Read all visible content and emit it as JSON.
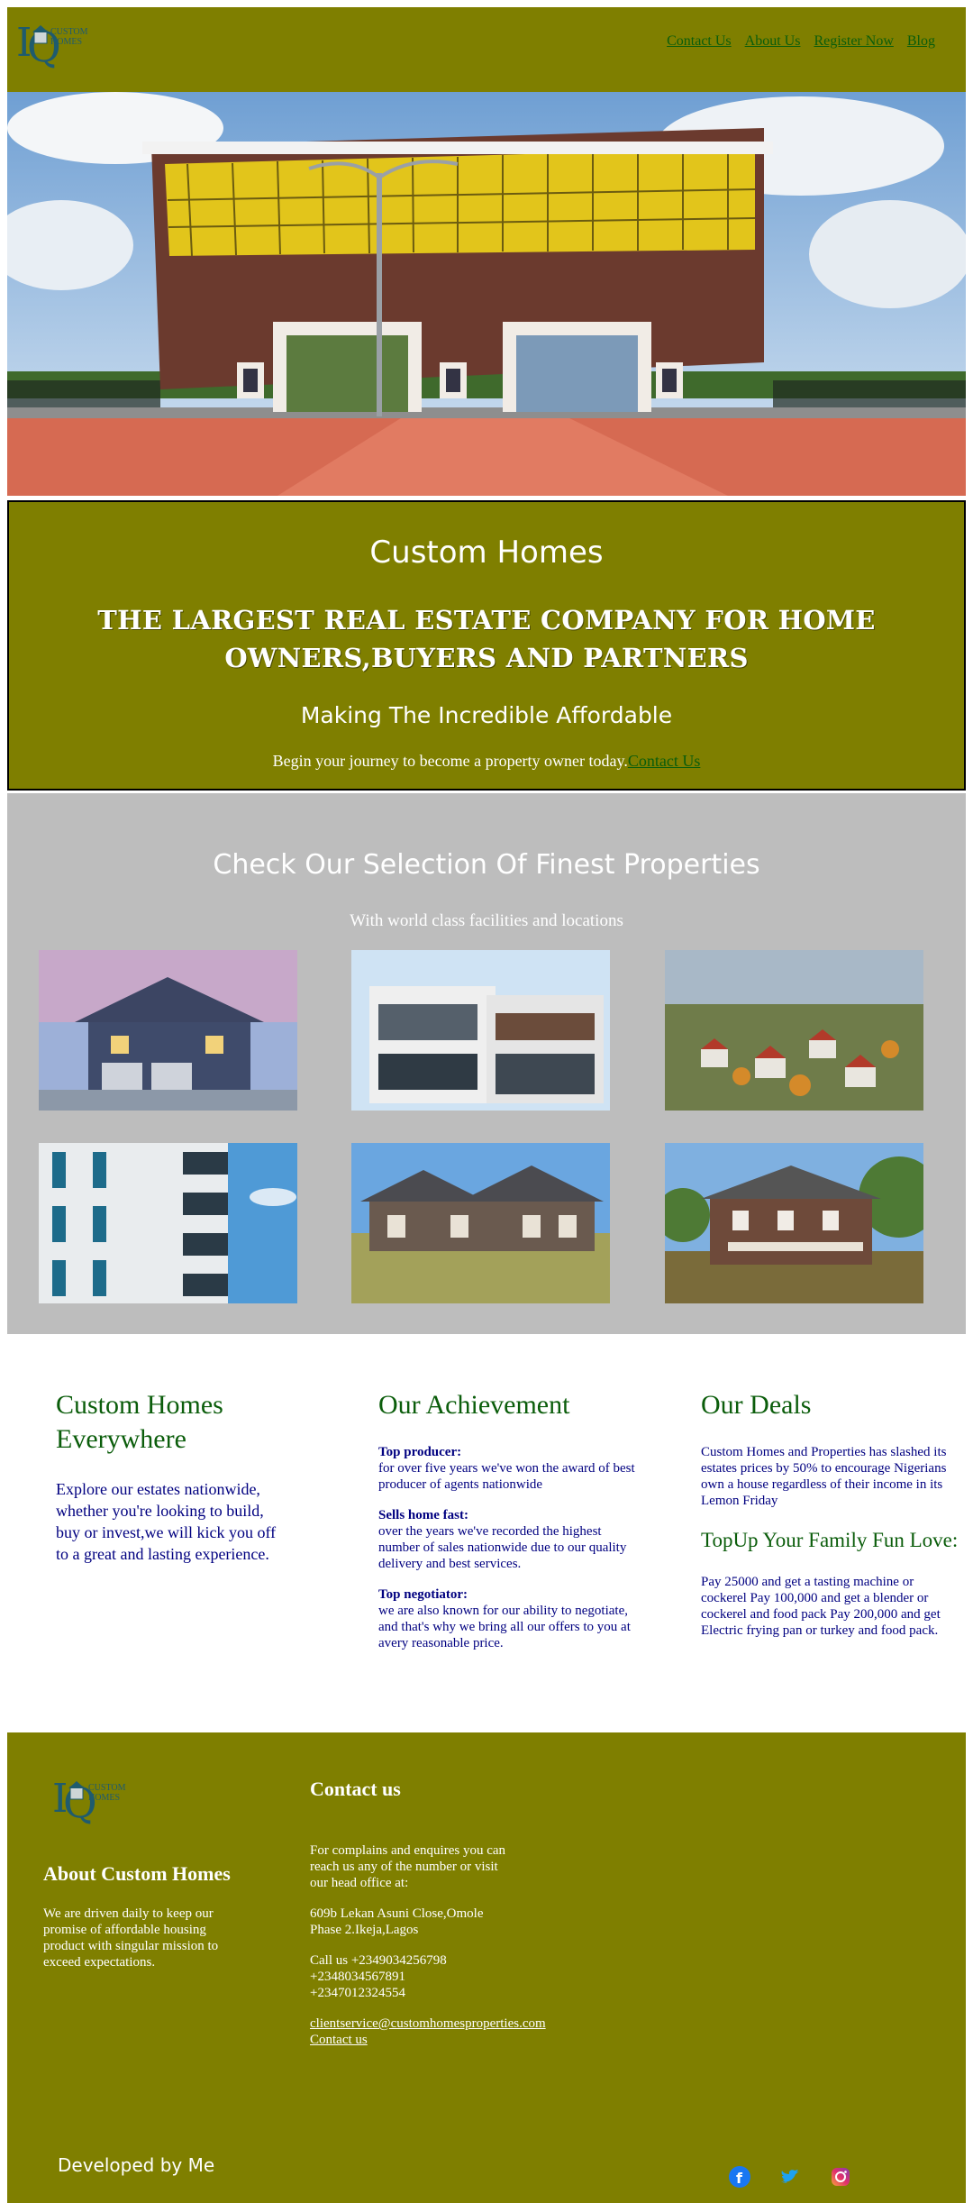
{
  "brand": {
    "logo_text": "CUSTOM HOMES",
    "logo_sub": "Making The Incredible Affordable"
  },
  "nav": {
    "items": [
      "Contact Us",
      "About Us",
      "Register Now",
      "Blog"
    ]
  },
  "intro": {
    "brand": "Custom Homes",
    "headline": "THE LARGEST REAL ESTATE COMPANY FOR HOME OWNERS,BUYERS AND PARTNERS",
    "tagline": "Making The Incredible Affordable",
    "journey_text": "Begin your journey to become a property owner today.",
    "journey_link": "Contact Us"
  },
  "properties": {
    "title": "Check Our Selection Of Finest Properties",
    "subtitle": "With world class facilities and locations"
  },
  "columns": {
    "col1": {
      "title": "Custom Homes Everywhere",
      "text": "Explore our estates nationwide, whether you're looking to build, buy or invest,we will kick you off to a great and lasting experience."
    },
    "col2": {
      "title": "Our Achievement",
      "items": [
        {
          "label": "Top producer:",
          "text": "for over five years we've won the award of best producer of agents nationwide"
        },
        {
          "label": "Sells home fast:",
          "text": "over the years we've recorded the highest number of sales nationwide due to our quality delivery and best services."
        },
        {
          "label": "Top negotiator:",
          "text": "we are also known for our ability to negotiate, and that's why we bring all our offers to you at avery reasonable price."
        }
      ]
    },
    "col3": {
      "title": "Our Deals",
      "text": "Custom Homes and Properties has slashed its estates prices by 50% to encourage Nigerians own a house regardless of their income in its Lemon Friday",
      "sub_title": "TopUp Your Family Fun Love:",
      "sub_text": "Pay 25000 and get a tasting machine or cockerel Pay 100,000 and get a blender or cockerel and food pack Pay 200,000 and get Electric frying pan or turkey and food pack."
    }
  },
  "footer": {
    "about_title": "About Custom Homes",
    "about_text": "We are driven daily to keep our promise of affordable housing product with singular mission to exceed expectations.",
    "contact_title": "Contact us",
    "contact_intro": "For complains and enquires you can reach us any of the number or visit our head office at:",
    "address": "609b Lekan Asuni Close,Omole Phase 2.Ikeja,Lagos",
    "phone_1": "Call us +2349034256798",
    "phone_2": "+2348034567891",
    "phone_3": "+2347012324554",
    "email": "clientservice@customhomesproperties.com",
    "contact_link": "Contact us",
    "developer": "Developed by Me"
  },
  "colors": {
    "olive": "#7f7f00",
    "link_green": "#0b5d0b",
    "text_navy": "#000080",
    "gray_band": "#bdbdbd"
  },
  "icons": [
    "facebook-icon",
    "twitter-icon",
    "instagram-icon"
  ]
}
